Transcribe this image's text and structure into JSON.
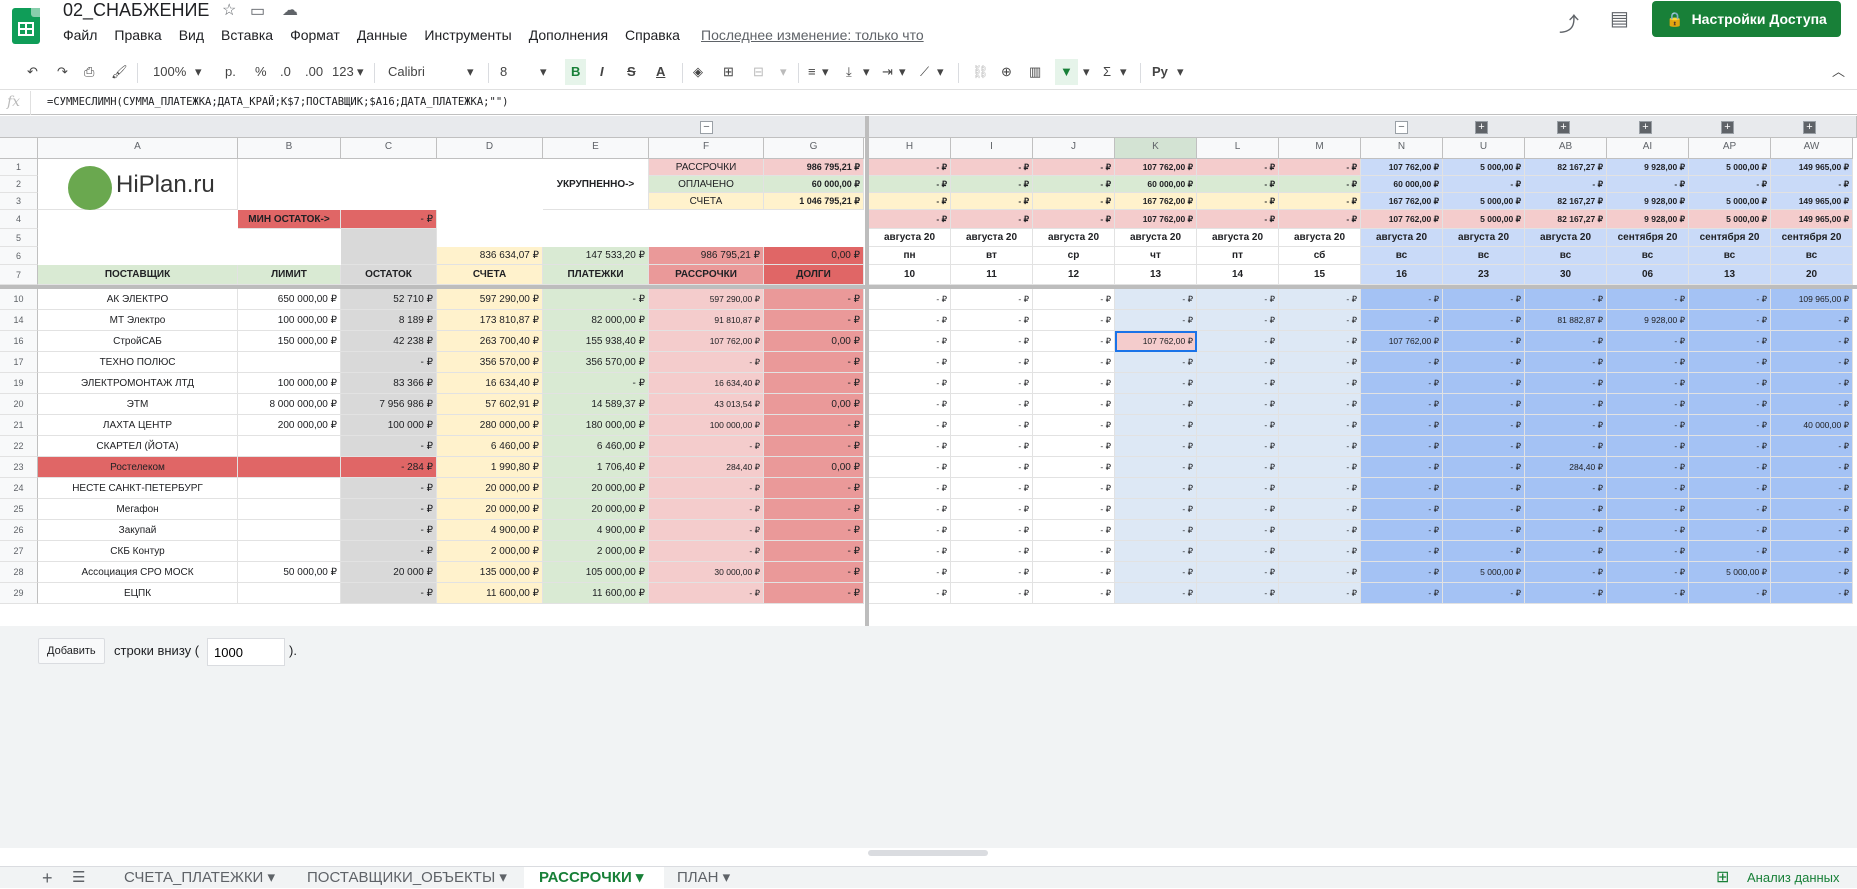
{
  "app": {
    "title": "02_СНАБЖЕНИЕ",
    "last_edit": "Последнее изменение: только что",
    "share": "Настройки Доступа"
  },
  "menu": [
    "Файл",
    "Правка",
    "Вид",
    "Вставка",
    "Формат",
    "Данные",
    "Инструменты",
    "Дополнения",
    "Справка"
  ],
  "toolbar": {
    "zoom": "100%",
    "currency": "р.",
    "percent": "%",
    "dec_less": ".0",
    "dec_more": ".00",
    "format": "123",
    "font": "Calibri",
    "size": "8"
  },
  "formula": {
    "fx": "fx",
    "text": "=СУММЕСЛИМН(СУММА_ПЛАТЕЖКА;ДАТА_КРАЙ;K$7;ПОСТАВЩИК;$A16;ДАТА_ПЛАТЕЖКА;\"\")"
  },
  "columns": [
    "A",
    "B",
    "C",
    "D",
    "E",
    "F",
    "G",
    "H",
    "I",
    "J",
    "K",
    "L",
    "M",
    "N",
    "U",
    "AB",
    "AI",
    "AP",
    "AW"
  ],
  "summary": {
    "logo": "HiPlan.ru",
    "ukr": "УКРУПНЕННО->",
    "min_label": "МИН ОСТАТОК->",
    "min_val": "-   ₽",
    "labels": [
      "РАССРОЧКИ",
      "ОПЛАЧЕНО",
      "СЧЕТА"
    ],
    "fvals": [
      "986 795,21 ₽",
      "60 000,00 ₽",
      "1 046 795,21 ₽"
    ],
    "row1": [
      "-   ₽",
      "-   ₽",
      "-   ₽",
      "107 762,00 ₽",
      "-   ₽",
      "-   ₽",
      "107 762,00 ₽",
      "5 000,00 ₽",
      "82 167,27 ₽",
      "9 928,00 ₽",
      "5 000,00 ₽",
      "149 965,00 ₽"
    ],
    "row2": [
      "-   ₽",
      "-   ₽",
      "-   ₽",
      "60 000,00 ₽",
      "-   ₽",
      "-   ₽",
      "60 000,00 ₽",
      "-   ₽",
      "-   ₽",
      "-   ₽",
      "-   ₽",
      "-   ₽"
    ],
    "row3": [
      "-   ₽",
      "-   ₽",
      "-   ₽",
      "167 762,00 ₽",
      "-   ₽",
      "-   ₽",
      "167 762,00 ₽",
      "5 000,00 ₽",
      "82 167,27 ₽",
      "9 928,00 ₽",
      "5 000,00 ₽",
      "149 965,00 ₽"
    ],
    "row4": [
      "-   ₽",
      "-   ₽",
      "-   ₽",
      "107 762,00 ₽",
      "-   ₽",
      "-   ₽",
      "107 762,00 ₽",
      "5 000,00 ₽",
      "82 167,27 ₽",
      "9 928,00 ₽",
      "5 000,00 ₽",
      "149 965,00 ₽"
    ],
    "months": [
      "августа 20",
      "августа 20",
      "августа 20",
      "августа 20",
      "августа 20",
      "августа 20",
      "августа 20",
      "августа 20",
      "августа 20",
      "сентября 20",
      "сентября 20",
      "сентября 20"
    ],
    "dows": [
      "пн",
      "вт",
      "ср",
      "чт",
      "пт",
      "сб",
      "вс",
      "вс",
      "вс",
      "вс",
      "вс",
      "вс"
    ],
    "days": [
      "10",
      "11",
      "12",
      "13",
      "14",
      "15",
      "16",
      "23",
      "30",
      "06",
      "13",
      "20"
    ],
    "totals": [
      "836 634,07 ₽",
      "147 533,20 ₽",
      "986 795,21 ₽",
      "0,00 ₽"
    ],
    "headers": [
      "ПОСТАВЩИК",
      "ЛИМИТ",
      "ОСТАТОК",
      "СЧЕТА",
      "ПЛАТЕЖКИ",
      "РАССРОЧКИ",
      "ДОЛГИ"
    ]
  },
  "rows": [
    {
      "n": "10",
      "a": "АК ЭЛЕКТРО",
      "b": "650 000,00 ₽",
      "c": "52 710 ₽",
      "d": "597 290,00 ₽",
      "e": "-   ₽",
      "f": "597 290,00 ₽",
      "g": "-   ₽",
      "x": [
        "-   ₽",
        "-   ₽",
        "-   ₽",
        "-   ₽",
        "-   ₽",
        "-   ₽",
        "-   ₽",
        "-   ₽",
        "-   ₽",
        "-   ₽",
        "-   ₽",
        "109 965,00 ₽"
      ]
    },
    {
      "n": "14",
      "a": "МТ Электро",
      "b": "100 000,00 ₽",
      "c": "8 189 ₽",
      "d": "173 810,87 ₽",
      "e": "82 000,00 ₽",
      "f": "91 810,87 ₽",
      "g": "-   ₽",
      "x": [
        "-   ₽",
        "-   ₽",
        "-   ₽",
        "-   ₽",
        "-   ₽",
        "-   ₽",
        "-   ₽",
        "-   ₽",
        "81 882,87 ₽",
        "9 928,00 ₽",
        "-   ₽",
        "-   ₽"
      ]
    },
    {
      "n": "16",
      "a": "СтройСАБ",
      "b": "150 000,00 ₽",
      "c": "42 238 ₽",
      "d": "263 700,40 ₽",
      "e": "155 938,40 ₽",
      "f": "107 762,00 ₽",
      "g": "0,00 ₽",
      "x": [
        "-   ₽",
        "-   ₽",
        "-   ₽",
        "107 762,00 ₽",
        "-   ₽",
        "-   ₽",
        "107 762,00 ₽",
        "-   ₽",
        "-   ₽",
        "-   ₽",
        "-   ₽",
        "-   ₽"
      ]
    },
    {
      "n": "17",
      "a": "ТЕХНО ПОЛЮС",
      "b": "",
      "c": "- ₽",
      "d": "356 570,00 ₽",
      "e": "356 570,00 ₽",
      "f": "-   ₽",
      "g": "-   ₽",
      "x": [
        "-   ₽",
        "-   ₽",
        "-   ₽",
        "-   ₽",
        "-   ₽",
        "-   ₽",
        "-   ₽",
        "-   ₽",
        "-   ₽",
        "-   ₽",
        "-   ₽",
        "-   ₽"
      ]
    },
    {
      "n": "19",
      "a": "ЭЛЕКТРОМОНТАЖ ЛТД",
      "b": "100 000,00 ₽",
      "c": "83 366 ₽",
      "d": "16 634,40 ₽",
      "e": "-   ₽",
      "f": "16 634,40 ₽",
      "g": "-   ₽",
      "x": [
        "-   ₽",
        "-   ₽",
        "-   ₽",
        "-   ₽",
        "-   ₽",
        "-   ₽",
        "-   ₽",
        "-   ₽",
        "-   ₽",
        "-   ₽",
        "-   ₽",
        "-   ₽"
      ]
    },
    {
      "n": "20",
      "a": "ЭТМ",
      "b": "8 000 000,00 ₽",
      "c": "7 956 986 ₽",
      "d": "57 602,91 ₽",
      "e": "14 589,37 ₽",
      "f": "43 013,54 ₽",
      "g": "0,00 ₽",
      "x": [
        "-   ₽",
        "-   ₽",
        "-   ₽",
        "-   ₽",
        "-   ₽",
        "-   ₽",
        "-   ₽",
        "-   ₽",
        "-   ₽",
        "-   ₽",
        "-   ₽",
        "-   ₽"
      ]
    },
    {
      "n": "21",
      "a": "ЛАХТА ЦЕНТР",
      "b": "200 000,00 ₽",
      "c": "100 000 ₽",
      "d": "280 000,00 ₽",
      "e": "180 000,00 ₽",
      "f": "100 000,00 ₽",
      "g": "-   ₽",
      "x": [
        "-   ₽",
        "-   ₽",
        "-   ₽",
        "-   ₽",
        "-   ₽",
        "-   ₽",
        "-   ₽",
        "-   ₽",
        "-   ₽",
        "-   ₽",
        "-   ₽",
        "40 000,00 ₽"
      ]
    },
    {
      "n": "22",
      "a": "СКАРТЕЛ (ЙОТА)",
      "b": "",
      "c": "- ₽",
      "d": "6 460,00 ₽",
      "e": "6 460,00 ₽",
      "f": "-   ₽",
      "g": "-   ₽",
      "x": [
        "-   ₽",
        "-   ₽",
        "-   ₽",
        "-   ₽",
        "-   ₽",
        "-   ₽",
        "-   ₽",
        "-   ₽",
        "-   ₽",
        "-   ₽",
        "-   ₽",
        "-   ₽"
      ]
    },
    {
      "n": "23",
      "a": "Ростелеком",
      "b": "",
      "c": "-      284 ₽",
      "d": "1 990,80 ₽",
      "e": "1 706,40 ₽",
      "f": "284,40 ₽",
      "g": "0,00 ₽",
      "x": [
        "-   ₽",
        "-   ₽",
        "-   ₽",
        "-   ₽",
        "-   ₽",
        "-   ₽",
        "-   ₽",
        "-   ₽",
        "284,40 ₽",
        "-   ₽",
        "-   ₽",
        "-   ₽"
      ]
    },
    {
      "n": "24",
      "a": "НЕСТЕ САНКТ-ПЕТЕРБУРГ",
      "b": "",
      "c": "- ₽",
      "d": "20 000,00 ₽",
      "e": "20 000,00 ₽",
      "f": "-   ₽",
      "g": "-   ₽",
      "x": [
        "-   ₽",
        "-   ₽",
        "-   ₽",
        "-   ₽",
        "-   ₽",
        "-   ₽",
        "-   ₽",
        "-   ₽",
        "-   ₽",
        "-   ₽",
        "-   ₽",
        "-   ₽"
      ]
    },
    {
      "n": "25",
      "a": "Мегафон",
      "b": "",
      "c": "- ₽",
      "d": "20 000,00 ₽",
      "e": "20 000,00 ₽",
      "f": "-   ₽",
      "g": "-   ₽",
      "x": [
        "-   ₽",
        "-   ₽",
        "-   ₽",
        "-   ₽",
        "-   ₽",
        "-   ₽",
        "-   ₽",
        "-   ₽",
        "-   ₽",
        "-   ₽",
        "-   ₽",
        "-   ₽"
      ]
    },
    {
      "n": "26",
      "a": "Закупай",
      "b": "",
      "c": "- ₽",
      "d": "4 900,00 ₽",
      "e": "4 900,00 ₽",
      "f": "-   ₽",
      "g": "-   ₽",
      "x": [
        "-   ₽",
        "-   ₽",
        "-   ₽",
        "-   ₽",
        "-   ₽",
        "-   ₽",
        "-   ₽",
        "-   ₽",
        "-   ₽",
        "-   ₽",
        "-   ₽",
        "-   ₽"
      ]
    },
    {
      "n": "27",
      "a": "СКБ Контур",
      "b": "",
      "c": "- ₽",
      "d": "2 000,00 ₽",
      "e": "2 000,00 ₽",
      "f": "-   ₽",
      "g": "-   ₽",
      "x": [
        "-   ₽",
        "-   ₽",
        "-   ₽",
        "-   ₽",
        "-   ₽",
        "-   ₽",
        "-   ₽",
        "-   ₽",
        "-   ₽",
        "-   ₽",
        "-   ₽",
        "-   ₽"
      ]
    },
    {
      "n": "28",
      "a": "Ассоциация СРО МОСК",
      "b": "50 000,00 ₽",
      "c": "20 000 ₽",
      "d": "135 000,00 ₽",
      "e": "105 000,00 ₽",
      "f": "30 000,00 ₽",
      "g": "-   ₽",
      "x": [
        "-   ₽",
        "-   ₽",
        "-   ₽",
        "-   ₽",
        "-   ₽",
        "-   ₽",
        "-   ₽",
        "5 000,00 ₽",
        "-   ₽",
        "-   ₽",
        "5 000,00 ₽",
        "-   ₽"
      ]
    },
    {
      "n": "29",
      "a": "ЕЦПК",
      "b": "",
      "c": "- ₽",
      "d": "11 600,00 ₽",
      "e": "11 600,00 ₽",
      "f": "-   ₽",
      "g": "-   ₽",
      "x": [
        "-   ₽",
        "-   ₽",
        "-   ₽",
        "-   ₽",
        "-   ₽",
        "-   ₽",
        "-   ₽",
        "-   ₽",
        "-   ₽",
        "-   ₽",
        "-   ₽",
        "-   ₽"
      ]
    }
  ],
  "addrows": {
    "button": "Добавить",
    "text": "строки внизу (",
    "value": "1000",
    "suffix": ")."
  },
  "sheets": [
    "СЧЕТА_ПЛАТЕЖКИ",
    "ПОСТАВЩИКИ_ОБЪЕКТЫ",
    "РАССРОЧКИ",
    "ПЛАН"
  ],
  "explore": "Анализ данных"
}
